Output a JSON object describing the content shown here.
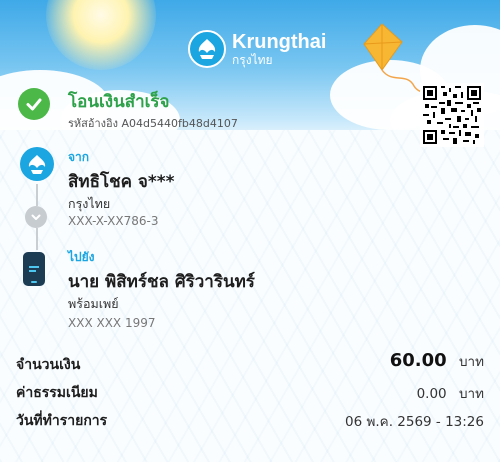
{
  "brand": {
    "name_en": "Krungthai",
    "name_th": "กรุงไทย"
  },
  "status": {
    "title": "โอนเงินสำเร็จ",
    "reference": "รหัสอ้างอิง A04d5440fb48d4107"
  },
  "sender": {
    "label": "จาก",
    "name": "สิทธิโชค จ***",
    "bank": "กรุงไทย",
    "account": "XXX-X-XX786-3"
  },
  "recipient": {
    "label": "ไปยัง",
    "name": "นาย พิสิทร์ชล ศิริวารินทร์",
    "bank": "พร้อมเพย์",
    "account": "XXX XXX 1997"
  },
  "details": {
    "amount_label": "จำนวนเงิน",
    "amount_value": "60.00",
    "amount_unit": "บาท",
    "fee_label": "ค่าธรรมเนียม",
    "fee_value": "0.00",
    "fee_unit": "บาท",
    "date_label": "วันที่ทำรายการ",
    "date_value": "06 พ.ค. 2569 - 13:26"
  },
  "colors": {
    "brand_blue": "#1ba5e1",
    "success_green": "#2ea24a",
    "check_green": "#4cb848"
  },
  "icons": [
    "krungthai-logo-icon",
    "kite-icon",
    "qr-code-icon",
    "check-icon",
    "bank-icon",
    "chevron-down-icon",
    "phone-icon"
  ]
}
